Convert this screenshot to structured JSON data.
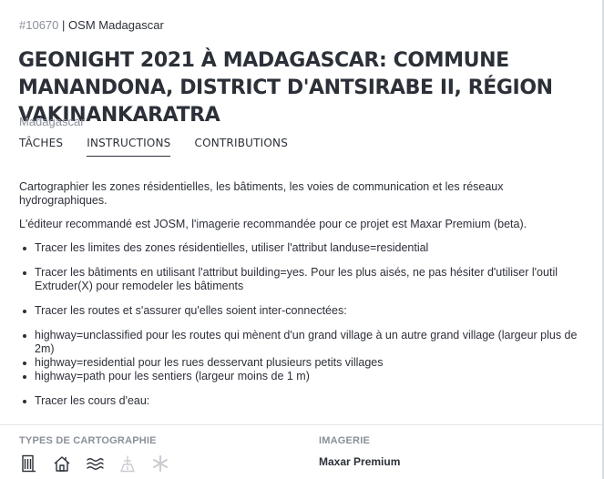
{
  "project": {
    "id": "#10670",
    "separator": "|",
    "organisation": "OSM Madagascar",
    "title": "GeoNight 2021 à Madagascar: Commune Manandona, District d'Antsirabe II, Région Vakinankaratra",
    "country": "Madagascar"
  },
  "tabs": [
    {
      "label": "Tâches",
      "active": false
    },
    {
      "label": "Instructions",
      "active": true
    },
    {
      "label": "Contributions",
      "active": false
    }
  ],
  "instructions": {
    "intro": "Cartographier les zones résidentielles, les bâtiments, les voies de communication et les réseaux hydrographiques.",
    "editor": "L'éditeur recommandé est JOSM, l'imagerie recommandée pour ce projet est Maxar Premium (beta).",
    "bullets": [
      "Tracer les limites des zones résidentielles, utiliser l'attribut landuse=residential",
      "Tracer les bâtiments en utilisant l'attribut building=yes. Pour les plus aisés, ne pas hésiter d'utiliser l'outil Extruder(X) pour remodeler les bâtiments",
      "Tracer les routes et s'assurer qu'elles soient inter-connectées:",
      "highway=unclassified pour les routes qui mènent d'un grand village à un autre grand village (largeur plus de 2m)",
      "highway=residential pour les rues desservant plusieurs petits villages",
      "highway=path pour les sentiers (largeur moins de 1 m)",
      "Tracer les cours d'eau:"
    ]
  },
  "mapping_types": {
    "label": "Types de cartographie",
    "icons": [
      {
        "name": "building-icon",
        "active": true
      },
      {
        "name": "home-icon",
        "active": true
      },
      {
        "name": "waterways-icon",
        "active": true
      },
      {
        "name": "road-icon",
        "active": false
      },
      {
        "name": "other-icon",
        "active": false
      }
    ]
  },
  "imagery": {
    "label": "Imagerie",
    "value": "Maxar Premium"
  },
  "colors": {
    "text": "#2c3038",
    "muted": "#8a8f99",
    "inactive_icon": "#c9ccd1"
  }
}
